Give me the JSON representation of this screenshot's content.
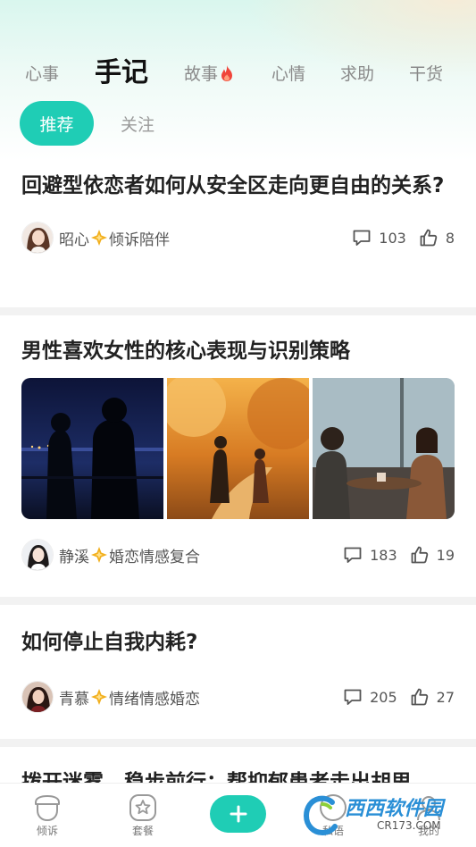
{
  "category_tabs": [
    {
      "label": "心事"
    },
    {
      "label": "手记"
    },
    {
      "label": "故事"
    },
    {
      "label": "心情"
    },
    {
      "label": "求助"
    },
    {
      "label": "干货"
    }
  ],
  "active_category": "手记",
  "sub_tabs": [
    {
      "label": "推荐"
    },
    {
      "label": "关注"
    }
  ],
  "posts": [
    {
      "title": "回避型依恋者如何从安全区走向更自由的关系?",
      "author": "昭心",
      "author_tag": "倾诉陪伴",
      "comments": "103",
      "likes": "8"
    },
    {
      "title": "男性喜欢女性的核心表现与识别策略",
      "author": "静溪",
      "author_tag": "婚恋情感复合",
      "comments": "183",
      "likes": "19"
    },
    {
      "title": "如何停止自我内耗?",
      "author": "青慕",
      "author_tag": "情绪情感婚恋",
      "comments": "205",
      "likes": "27"
    },
    {
      "title": "拨开迷雾，稳步前行：帮抑郁患者走出胡思"
    }
  ],
  "bottom_nav": [
    {
      "label": "倾诉",
      "icon": "acorn-icon"
    },
    {
      "label": "套餐",
      "icon": "star-icon"
    },
    {
      "label": "",
      "icon": "plus-icon"
    },
    {
      "label": "私语",
      "icon": "chat-icon"
    },
    {
      "label": "我的",
      "icon": "person-icon"
    }
  ],
  "watermark": {
    "brand": "西西软件园",
    "site": "CR173.COM"
  },
  "colors": {
    "accent": "#1fcdb5",
    "fire": "#f0453a",
    "badge": "#f2b01e"
  }
}
